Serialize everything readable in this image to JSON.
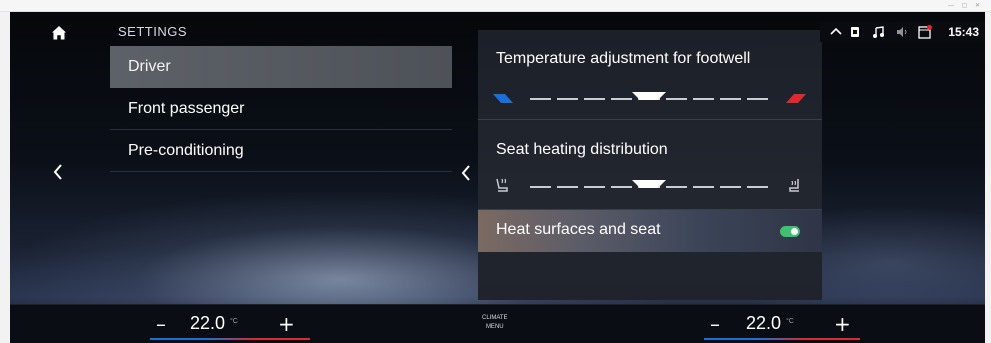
{
  "window": {
    "title": "",
    "controls": "— ▢ ✕"
  },
  "left": {
    "heading": "SETTINGS",
    "menu": [
      {
        "label": "Driver",
        "selected": true
      },
      {
        "label": "Front passenger",
        "selected": false
      },
      {
        "label": "Pre-conditioning",
        "selected": false
      }
    ]
  },
  "panel": {
    "footwell": {
      "title": "Temperature adjustment for footwell",
      "level": 0.5
    },
    "distribution": {
      "title": "Seat heating distribution",
      "level": 0.5
    },
    "heat_surfaces": {
      "title": "Heat surfaces and seat",
      "enabled": true
    }
  },
  "status_bar": {
    "icons": [
      "chevron-up-icon",
      "sim-icon",
      "music-note-icon",
      "volume-icon",
      "calendar-icon"
    ],
    "time": "15:43"
  },
  "climate": {
    "left_temp": "22.0",
    "right_temp": "22.0",
    "unit": "°C",
    "minus": "–",
    "plus": "+",
    "menu_line1": "CLIMATE",
    "menu_line2": "MENU"
  },
  "colors": {
    "accent_blue": "#1a6fd8",
    "accent_red": "#e0282e",
    "toggle_on": "#3fc270",
    "selected_row": "#5d6168"
  }
}
